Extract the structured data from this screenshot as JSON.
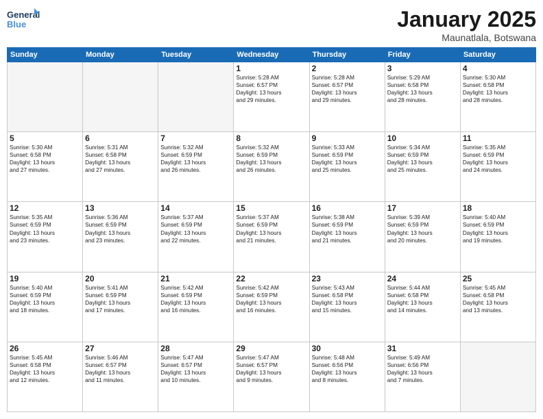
{
  "logo": {
    "line1": "General",
    "line2": "Blue"
  },
  "title": "January 2025",
  "location": "Maunatlala, Botswana",
  "weekdays": [
    "Sunday",
    "Monday",
    "Tuesday",
    "Wednesday",
    "Thursday",
    "Friday",
    "Saturday"
  ],
  "weeks": [
    [
      {
        "day": "",
        "info": ""
      },
      {
        "day": "",
        "info": ""
      },
      {
        "day": "",
        "info": ""
      },
      {
        "day": "1",
        "info": "Sunrise: 5:28 AM\nSunset: 6:57 PM\nDaylight: 13 hours\nand 29 minutes."
      },
      {
        "day": "2",
        "info": "Sunrise: 5:28 AM\nSunset: 6:57 PM\nDaylight: 13 hours\nand 29 minutes."
      },
      {
        "day": "3",
        "info": "Sunrise: 5:29 AM\nSunset: 6:58 PM\nDaylight: 13 hours\nand 28 minutes."
      },
      {
        "day": "4",
        "info": "Sunrise: 5:30 AM\nSunset: 6:58 PM\nDaylight: 13 hours\nand 28 minutes."
      }
    ],
    [
      {
        "day": "5",
        "info": "Sunrise: 5:30 AM\nSunset: 6:58 PM\nDaylight: 13 hours\nand 27 minutes."
      },
      {
        "day": "6",
        "info": "Sunrise: 5:31 AM\nSunset: 6:58 PM\nDaylight: 13 hours\nand 27 minutes."
      },
      {
        "day": "7",
        "info": "Sunrise: 5:32 AM\nSunset: 6:59 PM\nDaylight: 13 hours\nand 26 minutes."
      },
      {
        "day": "8",
        "info": "Sunrise: 5:32 AM\nSunset: 6:59 PM\nDaylight: 13 hours\nand 26 minutes."
      },
      {
        "day": "9",
        "info": "Sunrise: 5:33 AM\nSunset: 6:59 PM\nDaylight: 13 hours\nand 25 minutes."
      },
      {
        "day": "10",
        "info": "Sunrise: 5:34 AM\nSunset: 6:59 PM\nDaylight: 13 hours\nand 25 minutes."
      },
      {
        "day": "11",
        "info": "Sunrise: 5:35 AM\nSunset: 6:59 PM\nDaylight: 13 hours\nand 24 minutes."
      }
    ],
    [
      {
        "day": "12",
        "info": "Sunrise: 5:35 AM\nSunset: 6:59 PM\nDaylight: 13 hours\nand 23 minutes."
      },
      {
        "day": "13",
        "info": "Sunrise: 5:36 AM\nSunset: 6:59 PM\nDaylight: 13 hours\nand 23 minutes."
      },
      {
        "day": "14",
        "info": "Sunrise: 5:37 AM\nSunset: 6:59 PM\nDaylight: 13 hours\nand 22 minutes."
      },
      {
        "day": "15",
        "info": "Sunrise: 5:37 AM\nSunset: 6:59 PM\nDaylight: 13 hours\nand 21 minutes."
      },
      {
        "day": "16",
        "info": "Sunrise: 5:38 AM\nSunset: 6:59 PM\nDaylight: 13 hours\nand 21 minutes."
      },
      {
        "day": "17",
        "info": "Sunrise: 5:39 AM\nSunset: 6:59 PM\nDaylight: 13 hours\nand 20 minutes."
      },
      {
        "day": "18",
        "info": "Sunrise: 5:40 AM\nSunset: 6:59 PM\nDaylight: 13 hours\nand 19 minutes."
      }
    ],
    [
      {
        "day": "19",
        "info": "Sunrise: 5:40 AM\nSunset: 6:59 PM\nDaylight: 13 hours\nand 18 minutes."
      },
      {
        "day": "20",
        "info": "Sunrise: 5:41 AM\nSunset: 6:59 PM\nDaylight: 13 hours\nand 17 minutes."
      },
      {
        "day": "21",
        "info": "Sunrise: 5:42 AM\nSunset: 6:59 PM\nDaylight: 13 hours\nand 16 minutes."
      },
      {
        "day": "22",
        "info": "Sunrise: 5:42 AM\nSunset: 6:59 PM\nDaylight: 13 hours\nand 16 minutes."
      },
      {
        "day": "23",
        "info": "Sunrise: 5:43 AM\nSunset: 6:58 PM\nDaylight: 13 hours\nand 15 minutes."
      },
      {
        "day": "24",
        "info": "Sunrise: 5:44 AM\nSunset: 6:58 PM\nDaylight: 13 hours\nand 14 minutes."
      },
      {
        "day": "25",
        "info": "Sunrise: 5:45 AM\nSunset: 6:58 PM\nDaylight: 13 hours\nand 13 minutes."
      }
    ],
    [
      {
        "day": "26",
        "info": "Sunrise: 5:45 AM\nSunset: 6:58 PM\nDaylight: 13 hours\nand 12 minutes."
      },
      {
        "day": "27",
        "info": "Sunrise: 5:46 AM\nSunset: 6:57 PM\nDaylight: 13 hours\nand 11 minutes."
      },
      {
        "day": "28",
        "info": "Sunrise: 5:47 AM\nSunset: 6:57 PM\nDaylight: 13 hours\nand 10 minutes."
      },
      {
        "day": "29",
        "info": "Sunrise: 5:47 AM\nSunset: 6:57 PM\nDaylight: 13 hours\nand 9 minutes."
      },
      {
        "day": "30",
        "info": "Sunrise: 5:48 AM\nSunset: 6:56 PM\nDaylight: 13 hours\nand 8 minutes."
      },
      {
        "day": "31",
        "info": "Sunrise: 5:49 AM\nSunset: 6:56 PM\nDaylight: 13 hours\nand 7 minutes."
      },
      {
        "day": "",
        "info": ""
      }
    ]
  ]
}
